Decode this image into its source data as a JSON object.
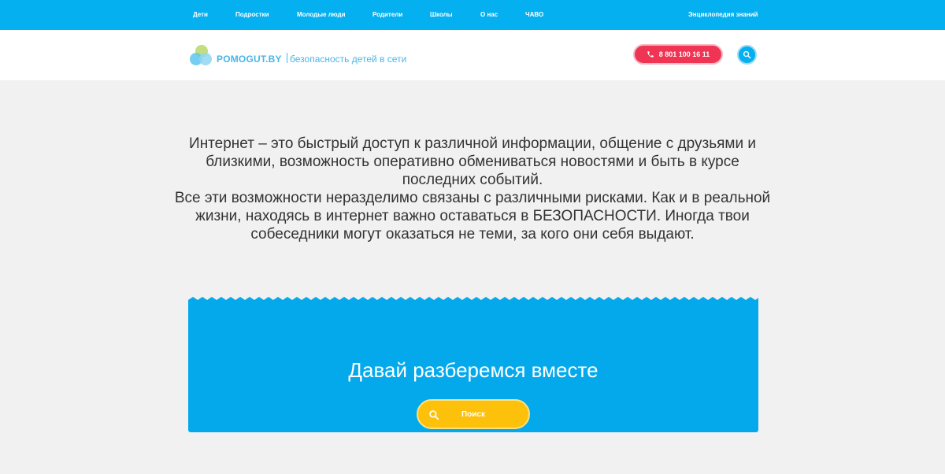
{
  "nav": {
    "items": [
      {
        "label": "Дети"
      },
      {
        "label": "Подростки"
      },
      {
        "label": "Молодые люди"
      },
      {
        "label": "Родители"
      },
      {
        "label": "Школы"
      },
      {
        "label": "О нас"
      },
      {
        "label": "ЧАВО"
      }
    ],
    "right_link": "Энциклопедия знаний"
  },
  "header": {
    "logo_name": "POMOGUT.BY",
    "logo_tagline": "безопасность детей в сети",
    "phone": "8 801 100 16 11"
  },
  "intro": {
    "paragraph1": "Интернет – это быстрый доступ к различной информации, общение с друзьями и близкими, возможность оперативно обмениваться новостями и быть в курсе последних событий.",
    "paragraph2": "Все эти возможности неразделимо связаны с различными рисками. Как и в реальной жизни, находясь в интернет важно оставаться в БЕЗОПАСНОСТИ. Иногда твои собеседники могут оказаться не теми, за кого они себя выдают."
  },
  "card": {
    "title": "Давай разберемся вместе",
    "search_label": "Поиск"
  },
  "colors": {
    "topbar": "#04b0f0",
    "card": "#04a9ec",
    "phone_button": "#ef3454",
    "search_button": "#fdc10c",
    "logo_text": "#48b6e8"
  },
  "icons": {
    "phone": "phone-icon",
    "header_search": "search-icon",
    "card_search": "search-icon"
  }
}
